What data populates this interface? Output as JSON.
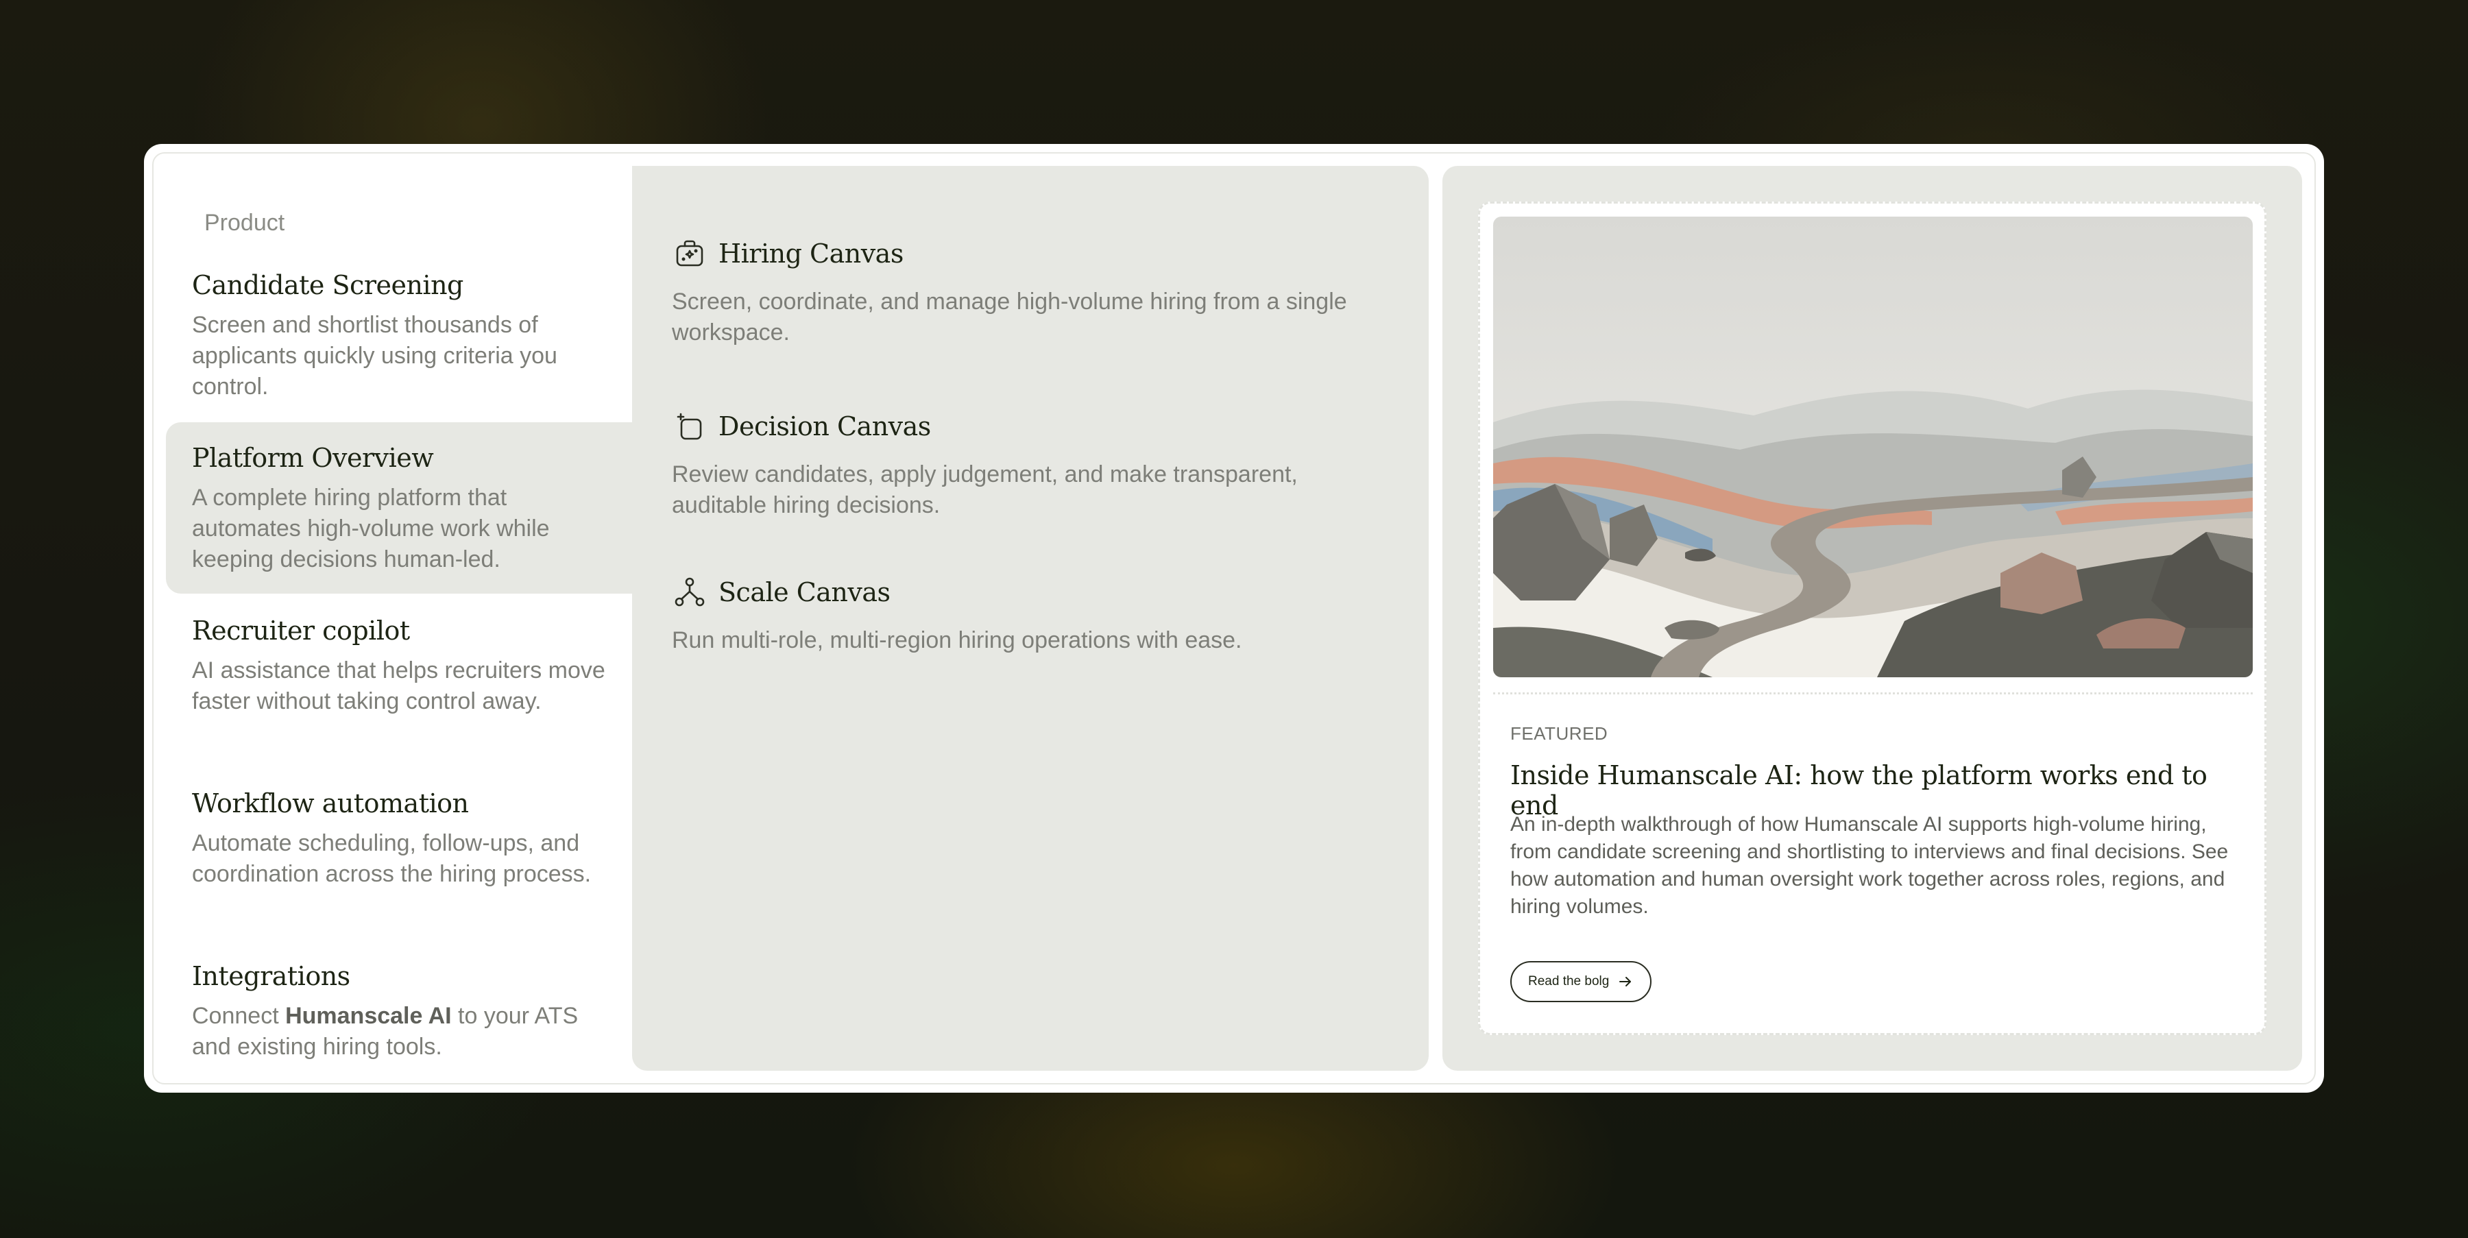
{
  "menu": {
    "section_label": "Product",
    "nav_items": [
      {
        "title": "Candidate Screening",
        "description": "Screen and shortlist thousands of applicants quickly using criteria you control.",
        "active": false
      },
      {
        "title": "Platform Overview",
        "description": "A complete hiring platform that automates high-volume work while keeping decisions human-led.",
        "active": true
      },
      {
        "title": "Recruiter copilot",
        "description": "AI assistance that helps recruiters move faster without taking control away.",
        "active": false
      },
      {
        "title": "Workflow automation",
        "description": "Automate scheduling, follow-ups, and coordination across the hiring process.",
        "active": false
      },
      {
        "title": "Integrations",
        "description_prefix": "Connect ",
        "description_bold": "Humanscale AI",
        "description_suffix": " to your ATS and existing hiring tools.",
        "active": false
      }
    ],
    "products": [
      {
        "icon": "briefcase-icon",
        "title": "Hiring Canvas",
        "description": "Screen, coordinate, and manage high-volume hiring from a single workspace."
      },
      {
        "icon": "decision-square-icon",
        "title": "Decision Canvas",
        "description": "Review candidates, apply judgement, and make transparent, auditable hiring decisions."
      },
      {
        "icon": "network-nodes-icon",
        "title": "Scale Canvas",
        "description": "Run multi-role, multi-region hiring operations with ease."
      }
    ],
    "featured": {
      "tag": "FEATURED",
      "title": "Inside Humanscale AI: how the platform works end to end",
      "description": "An in-depth walkthrough of how Humanscale AI supports high-volume hiring, from candidate screening and shortlisting to interviews and final decisions. See how automation and human oversight work together across roles, regions, and hiring volumes.",
      "button_label": "Read the bolg",
      "button_icon": "arrow-right-icon",
      "image": "landscape-illustration"
    }
  },
  "colors": {
    "panel_bg": "#e7e8e3",
    "heading": "#1d2414",
    "muted_text": "#7d7e78",
    "page_bg": "#15140b"
  }
}
